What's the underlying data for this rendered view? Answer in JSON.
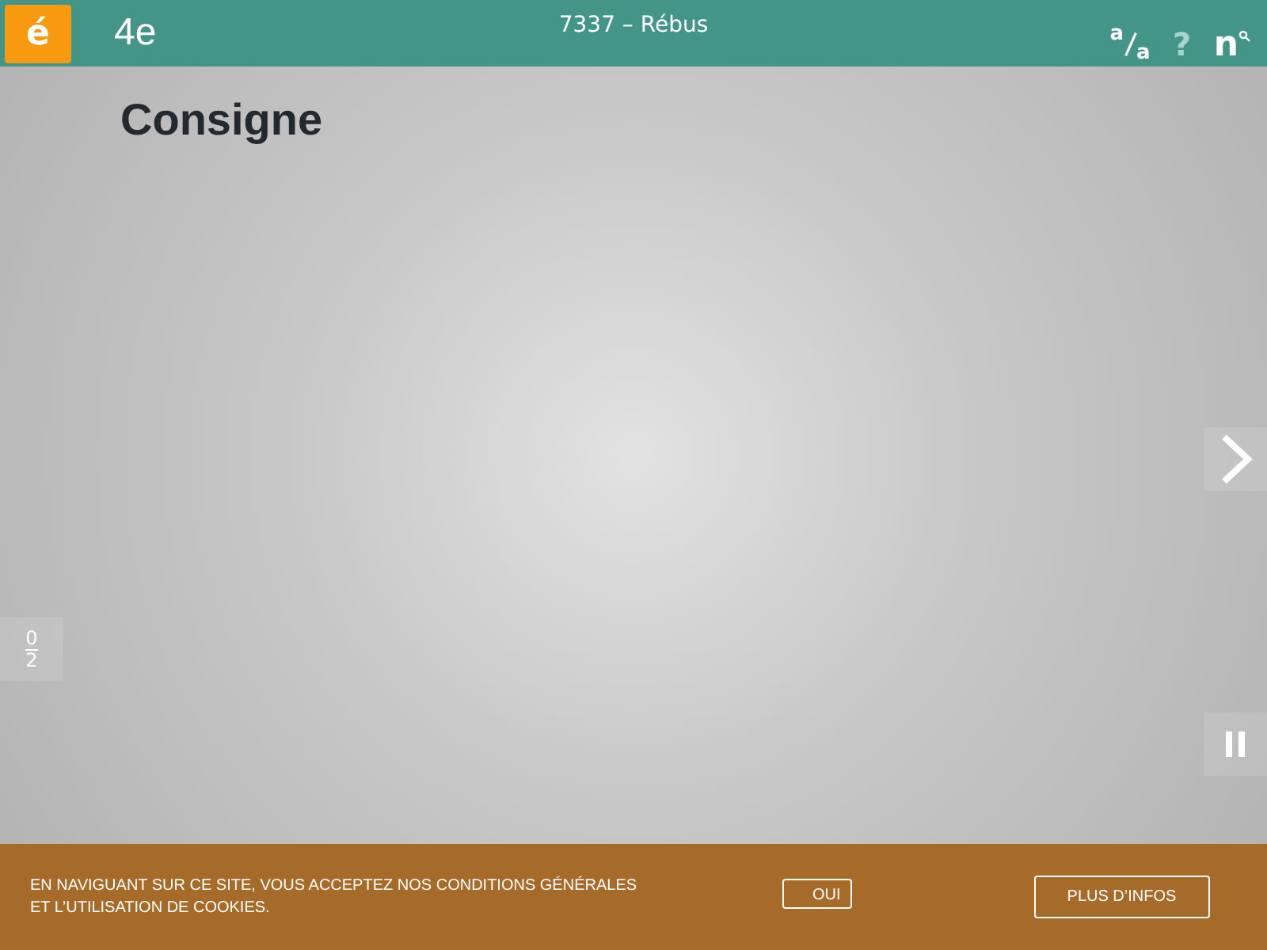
{
  "header": {
    "logo": "é",
    "level": "4e",
    "title": "7337 – Rébus",
    "text_size": {
      "top": "a",
      "bottom": "a"
    },
    "help": {
      "label": "?",
      "disabled": true
    },
    "brand": {
      "letter": "n"
    }
  },
  "content": {
    "heading": "Consigne"
  },
  "score": {
    "done": "0",
    "total": "2"
  },
  "cookie_banner": {
    "text": "EN NAVIGUANT SUR CE SITE, VOUS ACCEPTEZ NOS CONDITIONS GÉNÉRALES ET L’UTILISATION DE COOKIES.",
    "accept": "OUI",
    "more": "PLUS D’INFOS"
  }
}
